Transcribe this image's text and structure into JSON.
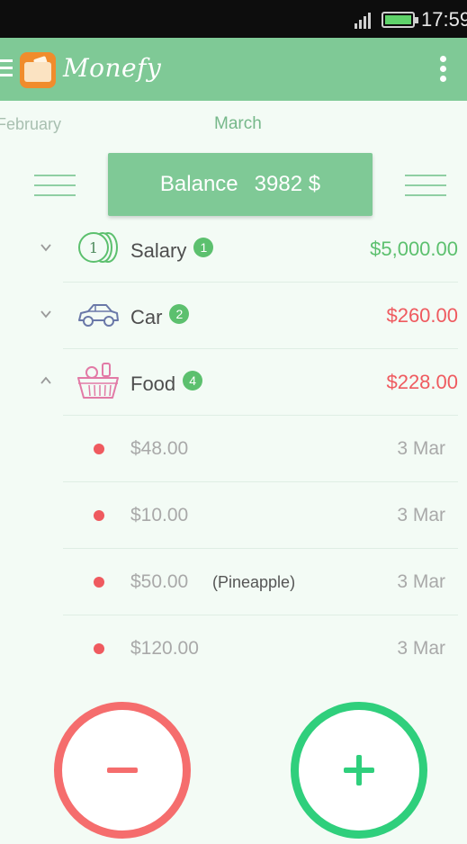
{
  "status_bar": {
    "time": "17:59"
  },
  "app": {
    "name": "Monefy"
  },
  "months": {
    "previous": "February",
    "current": "March"
  },
  "balance": {
    "label": "Balance",
    "value": "3982 $"
  },
  "categories": [
    {
      "name": "Salary",
      "count": "1",
      "amount": "$5,000.00",
      "type": "income",
      "icon": "coins-icon",
      "expanded": false
    },
    {
      "name": "Car",
      "count": "2",
      "amount": "$260.00",
      "type": "expense",
      "icon": "car-icon",
      "expanded": false
    },
    {
      "name": "Food",
      "count": "4",
      "amount": "$228.00",
      "type": "expense",
      "icon": "food-basket-icon",
      "expanded": true
    }
  ],
  "food_entries": [
    {
      "amount": "$48.00",
      "note": "",
      "date": "3 Mar"
    },
    {
      "amount": "$10.00",
      "note": "",
      "date": "3 Mar"
    },
    {
      "amount": "$50.00",
      "note": "(Pineapple)",
      "date": "3 Mar"
    },
    {
      "amount": "$120.00",
      "note": "",
      "date": "3 Mar"
    }
  ],
  "colors": {
    "primary": "#7fc996",
    "income": "#5cc06e",
    "expense": "#ef5a5f",
    "add_button": "#2fcf7c",
    "remove_button": "#f56d6d"
  }
}
